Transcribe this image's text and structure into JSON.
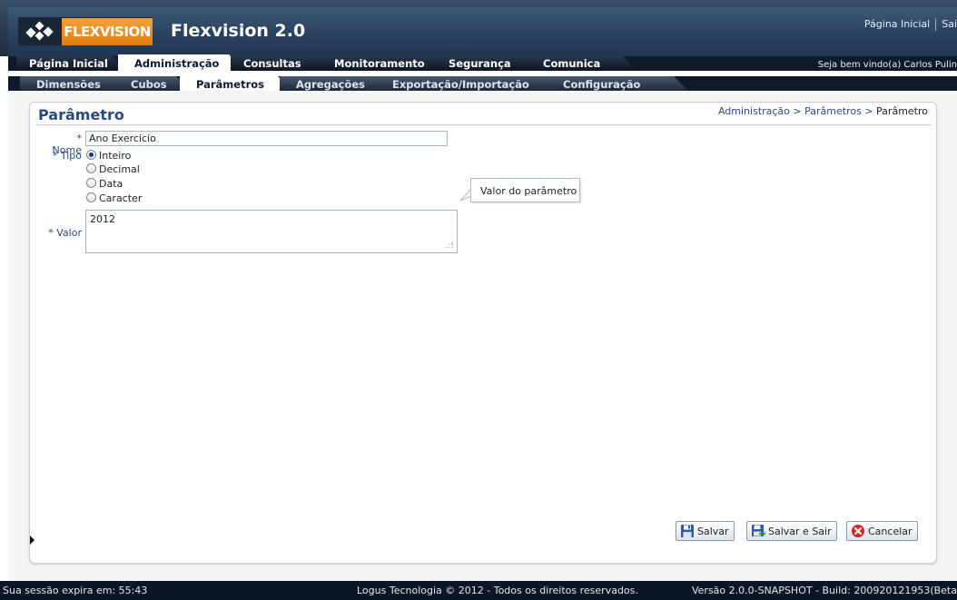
{
  "app": {
    "brand": "FLEXVISION",
    "title": "Flexvision 2.0"
  },
  "top_links": {
    "home": "Página Inicial",
    "logout": "Sai"
  },
  "welcome": "Seja bem vindo(a) Carlos Pulin",
  "main_tabs": [
    {
      "label": "Página Inicial",
      "active": false
    },
    {
      "label": "Administração",
      "active": true
    },
    {
      "label": "Consultas",
      "active": false
    },
    {
      "label": "Monitoramento",
      "active": false
    },
    {
      "label": "Segurança",
      "active": false
    },
    {
      "label": "Comunica",
      "active": false
    }
  ],
  "sub_tabs": [
    {
      "label": "Dimensões",
      "active": false
    },
    {
      "label": "Cubos",
      "active": false
    },
    {
      "label": "Parâmetros",
      "active": true
    },
    {
      "label": "Agregações",
      "active": false
    },
    {
      "label": "Exportação/Importação",
      "active": false
    },
    {
      "label": "Configuração",
      "active": false
    }
  ],
  "panel": {
    "title": "Parâmetro",
    "breadcrumb": {
      "part1": "Administração",
      "sep": ">",
      "part2": "Parâmetros",
      "current": "Parâmetro"
    }
  },
  "form": {
    "required_mark": "*",
    "nome_label": "Nome",
    "nome_value": "Ano Exercicio",
    "tipo_label": "Tipo",
    "tipo_options": [
      {
        "label": "Inteiro",
        "selected": true
      },
      {
        "label": "Decimal",
        "selected": false
      },
      {
        "label": "Data",
        "selected": false
      },
      {
        "label": "Caracter",
        "selected": false
      }
    ],
    "valor_label": "Valor",
    "valor_value": "2012",
    "tooltip": "Valor do parâmetro"
  },
  "buttons": {
    "save": "Salvar",
    "save_exit": "Salvar e Sair",
    "cancel": "Cancelar"
  },
  "footer": {
    "session": "Sua sessão expira em: 55:43",
    "copyright": "Logus Tecnologia © 2012 - Todos os direitos reservados.",
    "version": "Versão 2.0.0-SNAPSHOT - Build: 200920121953(Beta"
  },
  "colors": {
    "header_dark": "#213651",
    "brand_orange": "#e07c10",
    "title_blue": "#2b4a7e",
    "cancel_red": "#d8231f"
  }
}
